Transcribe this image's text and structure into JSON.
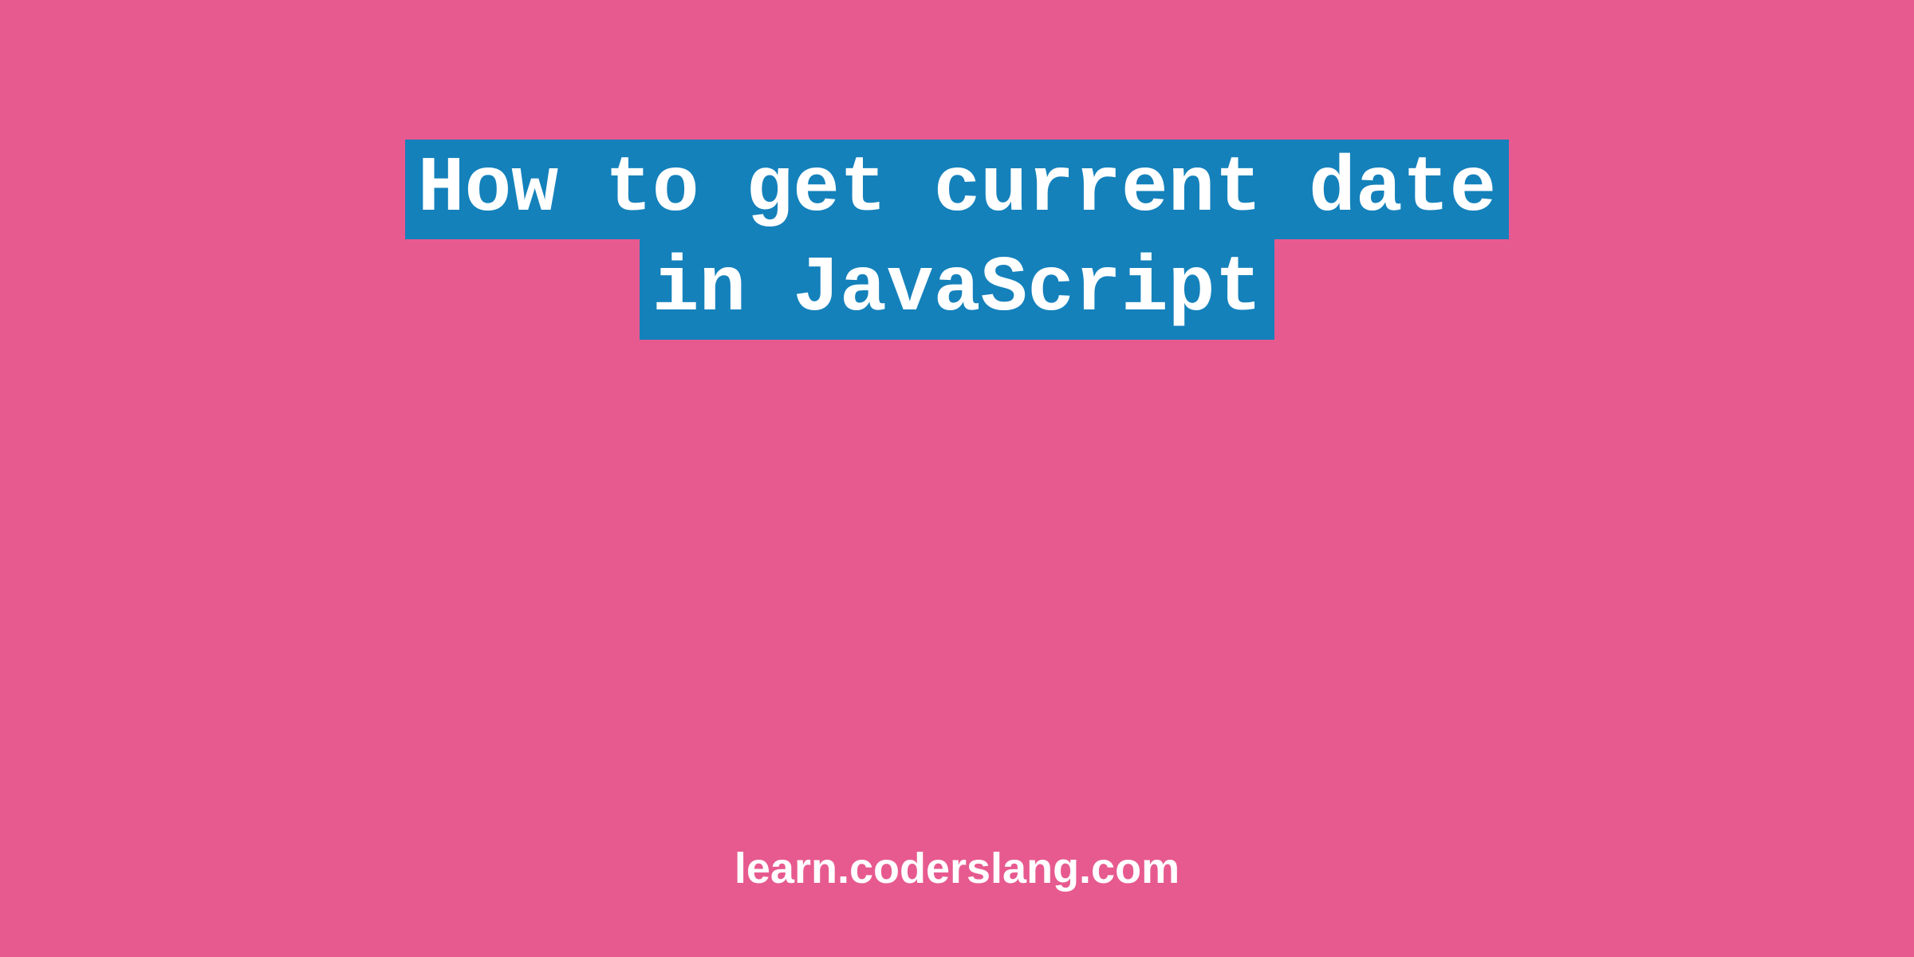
{
  "title": {
    "line1": "How to get current date",
    "line2": "in JavaScript"
  },
  "footer": {
    "text": "learn.coderslang.com"
  },
  "colors": {
    "background": "#e75a8f",
    "highlight": "#1481bb",
    "text": "#ffffff"
  }
}
